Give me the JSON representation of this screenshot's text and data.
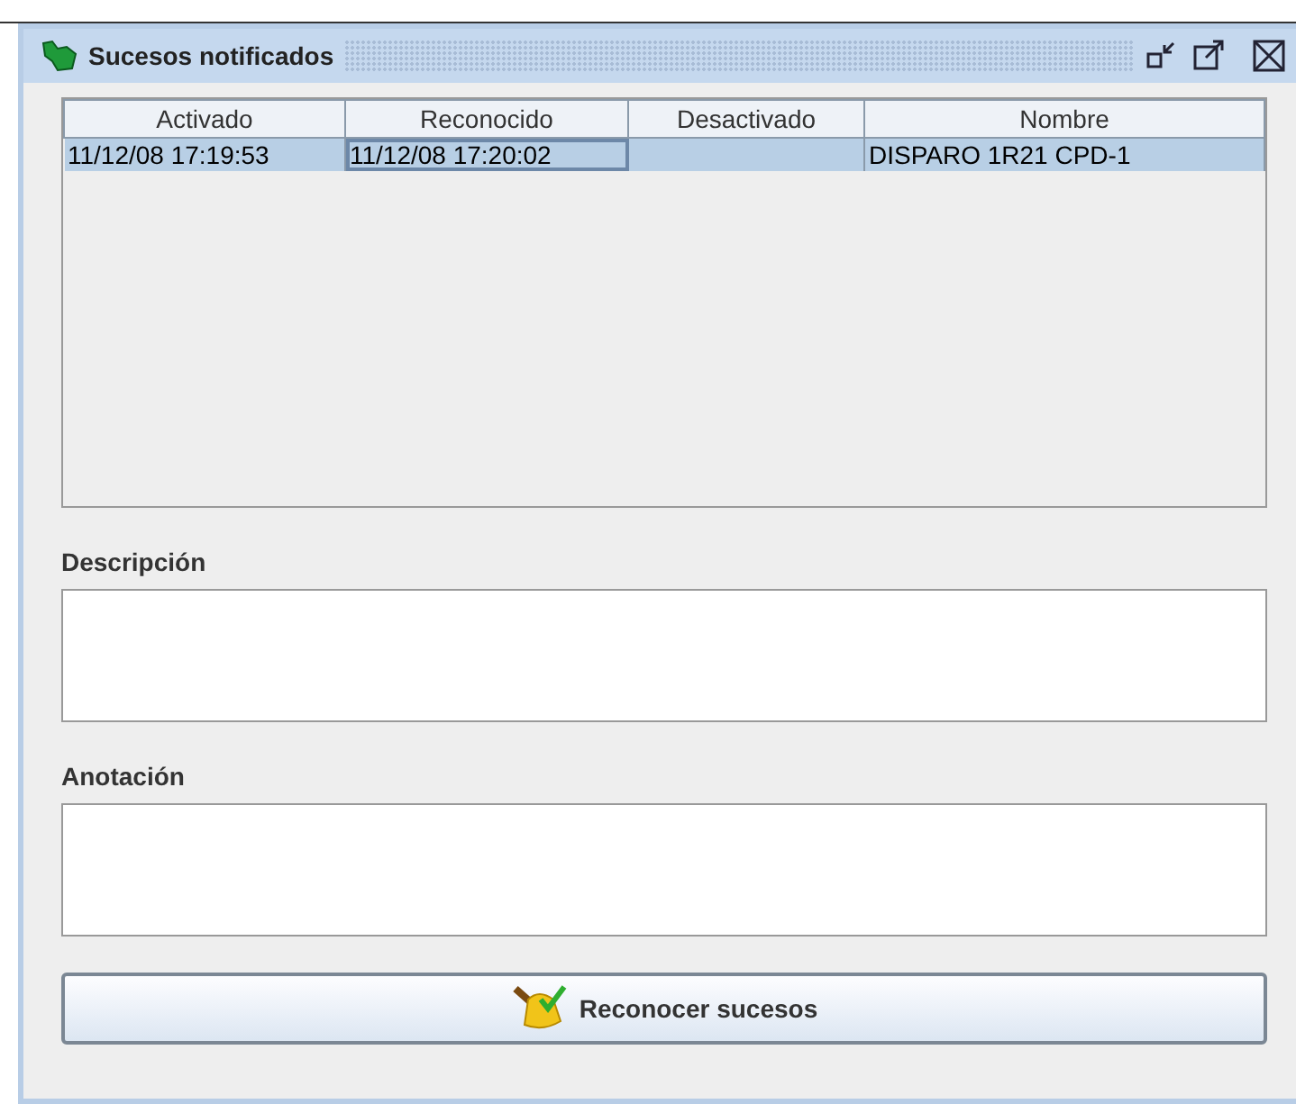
{
  "window": {
    "title": "Sucesos notificados"
  },
  "table": {
    "columns": [
      "Activado",
      "Reconocido",
      "Desactivado",
      "Nombre"
    ],
    "rows": [
      {
        "selected": true,
        "cells": [
          "11/12/08 17:19:53",
          "11/12/08 17:20:02",
          "",
          "DISPARO 1R21 CPD-1"
        ]
      }
    ]
  },
  "fields": [
    {
      "label": "Descripción"
    },
    {
      "label": "Anotación"
    }
  ],
  "button": {
    "label": "Reconocer sucesos"
  }
}
